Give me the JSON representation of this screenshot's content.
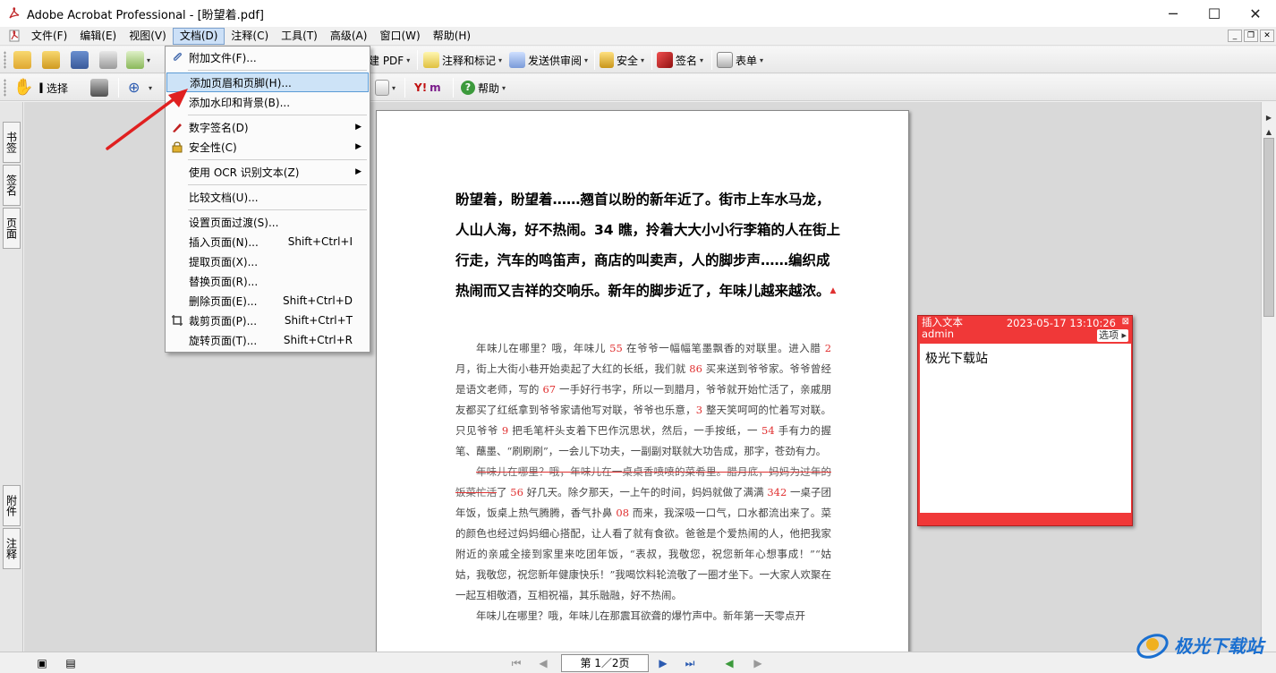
{
  "window": {
    "title": "Adobe Acrobat Professional - [盼望着.pdf]"
  },
  "menubar": [
    "文件(F)",
    "编辑(E)",
    "视图(V)",
    "文档(D)",
    "注释(C)",
    "工具(T)",
    "高级(A)",
    "窗口(W)",
    "帮助(H)"
  ],
  "toolbar1": {
    "create_pdf": "建 PDF",
    "comment_markup": "注释和标记",
    "send_review": "发送供审阅",
    "security": "安全",
    "sign": "签名",
    "forms": "表单"
  },
  "toolbar2": {
    "select": "选择",
    "help": "帮助"
  },
  "leftrail": {
    "bookmarks": "书签",
    "signatures": "签名",
    "pages": "页面",
    "attachments": "附件",
    "comments": "注释"
  },
  "doc_menu": {
    "items": [
      {
        "label": "附加文件(F)...",
        "shortcut": ""
      },
      {
        "label": "添加页眉和页脚(H)...",
        "shortcut": ""
      },
      {
        "label": "添加水印和背景(B)...",
        "shortcut": ""
      },
      {
        "label": "数字签名(D)",
        "shortcut": ""
      },
      {
        "label": "安全性(C)",
        "shortcut": ""
      },
      {
        "label": "使用 OCR 识别文本(Z)",
        "shortcut": ""
      },
      {
        "label": "比较文档(U)...",
        "shortcut": ""
      },
      {
        "label": "设置页面过渡(S)...",
        "shortcut": ""
      },
      {
        "label": "插入页面(N)...",
        "shortcut": "Shift+Ctrl+I"
      },
      {
        "label": "提取页面(X)...",
        "shortcut": ""
      },
      {
        "label": "替换页面(R)...",
        "shortcut": ""
      },
      {
        "label": "删除页面(E)...",
        "shortcut": "Shift+Ctrl+D"
      },
      {
        "label": "裁剪页面(P)...",
        "shortcut": "Shift+Ctrl+T"
      },
      {
        "label": "旋转页面(T)...",
        "shortcut": "Shift+Ctrl+R"
      }
    ]
  },
  "document": {
    "headline": "盼望着，盼望着……翘首以盼的新年近了。街市上车水马龙，人山人海，好不热闹。34 瞧，拎着大大小小行李箱的人在街上行走，汽车的鸣笛声，商店的叫卖声，人的脚步声……编织成热闹而又吉祥的交响乐。新年的脚步近了，年味儿越来越浓。",
    "p1": {
      "a": "年味儿在哪里？哦，年味儿 ",
      "n1": "55",
      "b": " 在爷爷一幅幅笔墨飘香的对联里。进入腊 ",
      "n2": "2",
      "c": " 月，街上大街小巷开始卖起了大红的长纸，我们就 ",
      "n3": "86",
      "d": " 买来送到爷爷家。爷爷曾经是语文老师，写的 ",
      "n4": "67",
      "e": " 一手好行书字，所以一到腊月，爷爷就开始忙活了，亲戚朋友都买了红纸拿到爷爷家请他写对联，爷爷也乐意，",
      "n5": "3",
      "f": " 整天笑呵呵的忙着写对联。只见爷爷 ",
      "n6": "9",
      "g": " 把毛笔杆头支着下巴作沉思状，然后，一手按纸，一 ",
      "n7": "54",
      "h": " 手有力的握笔、蘸墨、“刷刷刷”，一会儿下功夫，一副副对联就大功告成，那字，苍劲有力。"
    },
    "p2": {
      "strike": "年味儿在哪里？哦，年味儿在一桌桌香喷喷的菜肴里。腊月底，妈妈为过年的饭菜忙活",
      "a": "了 ",
      "n1": "56",
      "b": " 好几天。除夕那天，一上午的时间，妈妈就做了满满 ",
      "n2": "342",
      "c": " 一桌子团年饭，饭桌上热气腾腾，香气扑鼻 ",
      "n3": "08",
      "d": " 而来，我深吸一口气，口水都流出来了。菜的颜色也经过妈妈细心搭配，让人看了就有食欲。爸爸是个爱热闹的人，他把我家附近的亲戚全接到家里来吃团年饭，“表叔，我敬您，祝您新年心想事成！”“姑姑，我敬您，祝您新年健康快乐！”我喝饮料轮流敬了一圈才坐下。一大家人欢聚在一起互相敬酒，互相祝福，其乐融融，好不热闹。"
    },
    "p3": "年味儿在哪里？哦，年味儿在那震耳欲聋的爆竹声中。新年第一天零点开"
  },
  "note": {
    "type": "插入文本",
    "author": "admin",
    "date": "2023-05-17 13:10:26",
    "options": "选项",
    "content": "极光下载站"
  },
  "statusbar": {
    "page": "第 1／2页"
  },
  "watermark": {
    "text": "极光下载站"
  },
  "colors": {
    "accent_red": "#f03838",
    "menu_highlight": "#cde3f7"
  }
}
